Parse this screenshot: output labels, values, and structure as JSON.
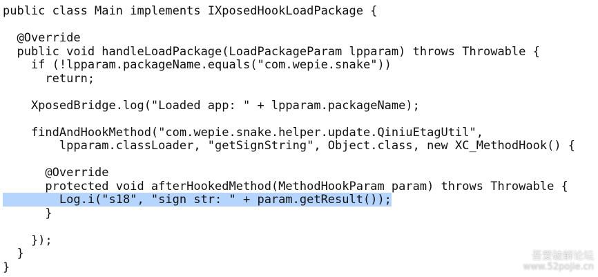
{
  "editor": {
    "lines": [
      "public class Main implements IXposedHookLoadPackage {",
      "",
      "  @Override",
      "  public void handleLoadPackage(LoadPackageParam lpparam) throws Throwable {",
      "    if (!lpparam.packageName.equals(\"com.wepie.snake\"))",
      "      return;",
      "",
      "    XposedBridge.log(\"Loaded app: \" + lpparam.packageName);",
      "",
      "    findAndHookMethod(\"com.wepie.snake.helper.update.QiniuEtagUtil\",",
      "        lpparam.classLoader, \"getSignString\", Object.class, new XC_MethodHook() {",
      "",
      "      @Override",
      "      protected void afterHookedMethod(MethodHookParam param) throws Throwable {",
      "        Log.i(\"s18\", \"sign str: \" + param.getResult());",
      "      }",
      "",
      "    });",
      "  }",
      "}"
    ],
    "selected_line_index": 14,
    "selection_color": "#b5d5ff",
    "text_color": "#111111",
    "background_color": "#ffffff"
  },
  "watermark": {
    "title": "吾爱破解论坛",
    "url": "www.52pojie.cn"
  }
}
